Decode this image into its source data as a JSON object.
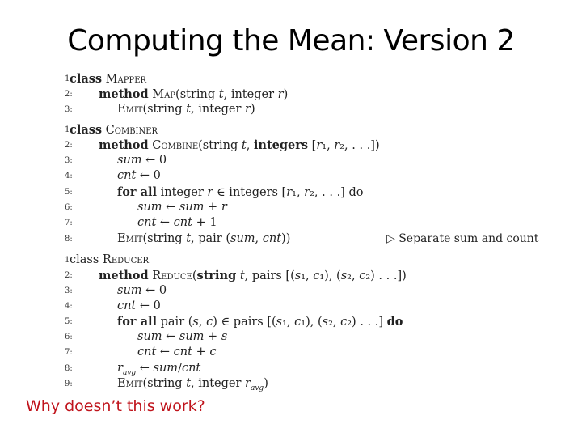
{
  "slide": {
    "title": "Computing the Mean: Version 2",
    "question": "Why doesn’t this work?",
    "question_color": "#c0141c"
  },
  "mapper": [
    {
      "num": "1:",
      "text": "class Mapper"
    },
    {
      "num": "2:",
      "text": "method Map(string t, integer r)"
    },
    {
      "num": "3:",
      "text": "Emit(string t, integer r)"
    }
  ],
  "combiner": [
    {
      "num": "1:",
      "text": "class Combiner"
    },
    {
      "num": "2:",
      "text": "method Combine(string t, integers [r₁, r₂, . . .])"
    },
    {
      "num": "3:",
      "text": "sum ← 0"
    },
    {
      "num": "4:",
      "text": "cnt ← 0"
    },
    {
      "num": "5:",
      "text": "for all integer r ∈ integers [r₁, r₂, . . .] do"
    },
    {
      "num": "6:",
      "text": "sum ← sum + r"
    },
    {
      "num": "7:",
      "text": "cnt ← cnt + 1"
    },
    {
      "num": "8:",
      "text": "Emit(string t, pair (sum, cnt))"
    }
  ],
  "combiner_comment": "▷ Separate sum and count",
  "reducer": [
    {
      "num": "1:",
      "text": "class Reducer"
    },
    {
      "num": "2:",
      "text": "method Reduce(string t, pairs [(s₁, c₁), (s₂, c₂) . . .])"
    },
    {
      "num": "3:",
      "text": "sum ← 0"
    },
    {
      "num": "4:",
      "text": "cnt ← 0"
    },
    {
      "num": "5:",
      "text": "for all pair (s, c) ∈ pairs [(s₁, c₁), (s₂, c₂) . . .] do"
    },
    {
      "num": "6:",
      "text": "sum ← sum + s"
    },
    {
      "num": "7:",
      "text": "cnt ← cnt + c"
    },
    {
      "num": "8:",
      "text": "r_avg ← sum/cnt"
    },
    {
      "num": "9:",
      "text": "Emit(string t, integer r_avg)"
    }
  ]
}
